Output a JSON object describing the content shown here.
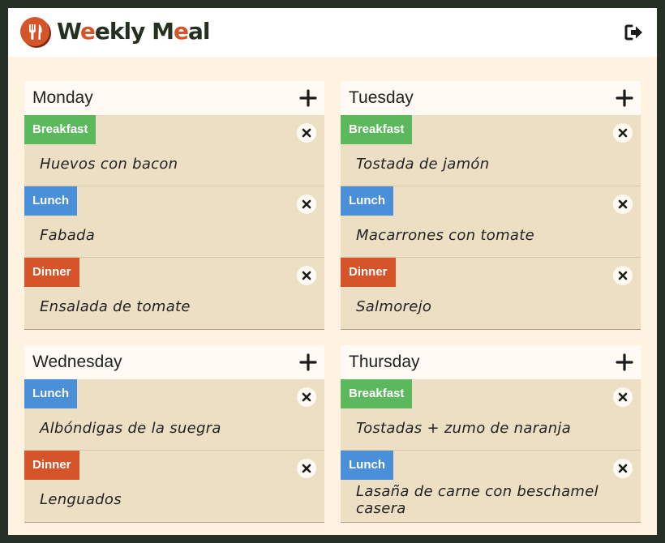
{
  "app": {
    "brand_before": "W",
    "brand_e1": "e",
    "brand_mid": "ekly M",
    "brand_e2": "e",
    "brand_after": "al"
  },
  "icons": {
    "logo": "fork-knife-icon",
    "logout": "logout-icon",
    "add": "plus-icon",
    "remove": "close-icon"
  },
  "colors": {
    "brand_accent": "#d6542a",
    "breakfast": "#5cb85c",
    "lunch": "#4a90d9",
    "dinner": "#d6542a"
  },
  "days": [
    {
      "name": "Monday",
      "meals": [
        {
          "type": "Breakfast",
          "dish": "Huevos con bacon"
        },
        {
          "type": "Lunch",
          "dish": "Fabada"
        },
        {
          "type": "Dinner",
          "dish": "Ensalada de tomate"
        }
      ]
    },
    {
      "name": "Tuesday",
      "meals": [
        {
          "type": "Breakfast",
          "dish": "Tostada de jamón"
        },
        {
          "type": "Lunch",
          "dish": "Macarrones con tomate"
        },
        {
          "type": "Dinner",
          "dish": "Salmorejo"
        }
      ]
    },
    {
      "name": "Wednesday",
      "meals": [
        {
          "type": "Lunch",
          "dish": "Albóndigas de la suegra"
        },
        {
          "type": "Dinner",
          "dish": "Lenguados"
        }
      ]
    },
    {
      "name": "Thursday",
      "meals": [
        {
          "type": "Breakfast",
          "dish": "Tostadas + zumo de naranja"
        },
        {
          "type": "Lunch",
          "dish": "Lasaña de carne con beschamel casera"
        }
      ]
    }
  ]
}
